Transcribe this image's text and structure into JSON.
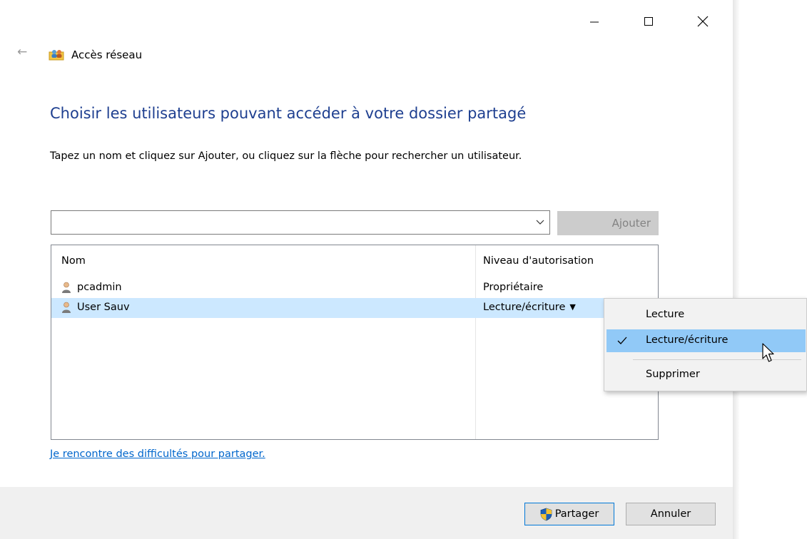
{
  "window": {
    "title": "Accès réseau",
    "controls": {
      "minimize": "—",
      "maximize": "☐",
      "close": "✕"
    }
  },
  "heading": "Choisir les utilisateurs pouvant accéder à votre dossier partagé",
  "instructions": "Tapez un nom et cliquez sur Ajouter, ou cliquez sur la flèche pour rechercher un utilisateur.",
  "user_input": {
    "value": "",
    "placeholder": ""
  },
  "add_button": "Ajouter",
  "table": {
    "columns": [
      "Nom",
      "Niveau d'autorisation"
    ],
    "rows": [
      {
        "name": "pcadmin",
        "permission": "Propriétaire"
      },
      {
        "name": "User Sauv",
        "permission": "Lecture/écriture"
      }
    ]
  },
  "permission_menu": {
    "items": [
      "Lecture",
      "Lecture/écriture",
      "Supprimer"
    ],
    "checked": "Lecture/écriture"
  },
  "help_link": "Je rencontre des difficultés pour partager.",
  "footer": {
    "share_button": "Partager",
    "cancel_button": "Annuler"
  },
  "colors": {
    "heading": "#1e3f90",
    "link": "#0066cc",
    "selection": "#cce8ff",
    "menu_hover": "#91c9f7",
    "accent": "#0078d7"
  }
}
